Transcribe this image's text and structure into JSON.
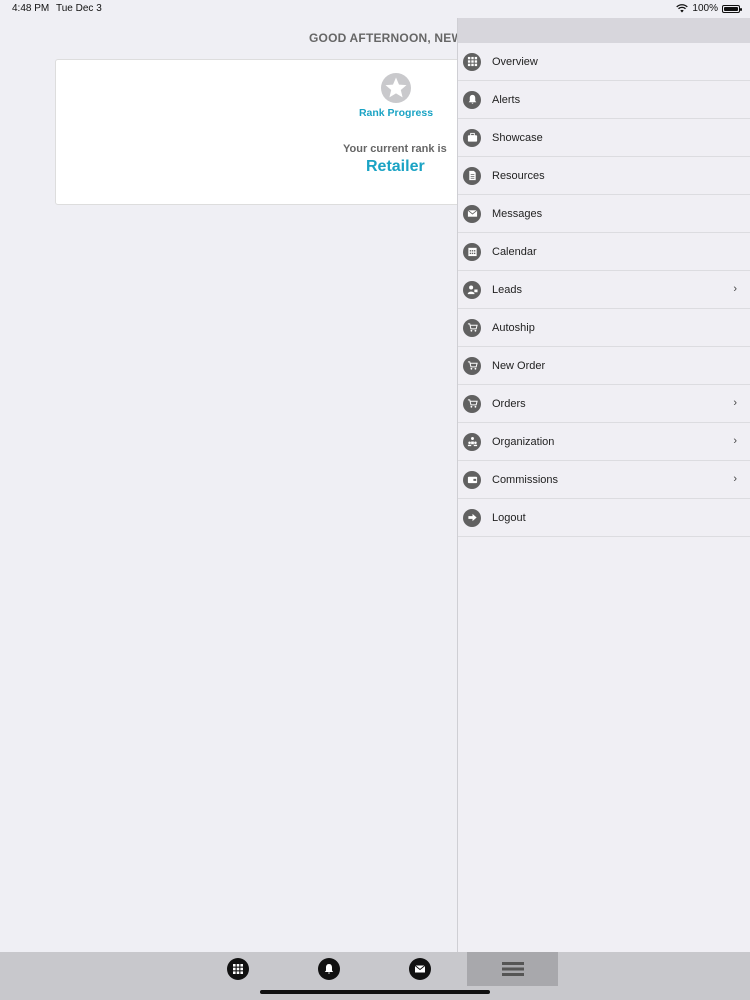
{
  "status_bar": {
    "time": "4:48 PM",
    "date": "Tue Dec 3",
    "battery": "100%"
  },
  "greeting": "GOOD AFTERNOON, NEW",
  "rank_card": {
    "title": "Rank Progress",
    "current_rank_label": "Your current rank is",
    "current_rank": "Retailer"
  },
  "menu": {
    "items": [
      {
        "label": "Overview",
        "icon": "grid-icon"
      },
      {
        "label": "Alerts",
        "icon": "bell-icon"
      },
      {
        "label": "Showcase",
        "icon": "briefcase-icon"
      },
      {
        "label": "Resources",
        "icon": "document-icon"
      },
      {
        "label": "Messages",
        "icon": "envelope-icon"
      },
      {
        "label": "Calendar",
        "icon": "calendar-icon"
      },
      {
        "label": "Leads",
        "icon": "leads-icon",
        "has_submenu": true
      },
      {
        "label": "Autoship",
        "icon": "cart-icon"
      },
      {
        "label": "New Order",
        "icon": "cart-icon"
      },
      {
        "label": "Orders",
        "icon": "cart-icon",
        "has_submenu": true
      },
      {
        "label": "Organization",
        "icon": "organization-icon",
        "has_submenu": true
      },
      {
        "label": "Commissions",
        "icon": "wallet-icon",
        "has_submenu": true
      },
      {
        "label": "Logout",
        "icon": "logout-icon"
      }
    ]
  },
  "tabbar": {
    "tabs": [
      "grid-icon",
      "bell-icon",
      "envelope-icon",
      "hamburger-menu-icon"
    ],
    "selected": "hamburger-menu-icon"
  },
  "colors": {
    "accent": "#1aa3c4",
    "icon": "#616161",
    "background": "#efeff4"
  }
}
